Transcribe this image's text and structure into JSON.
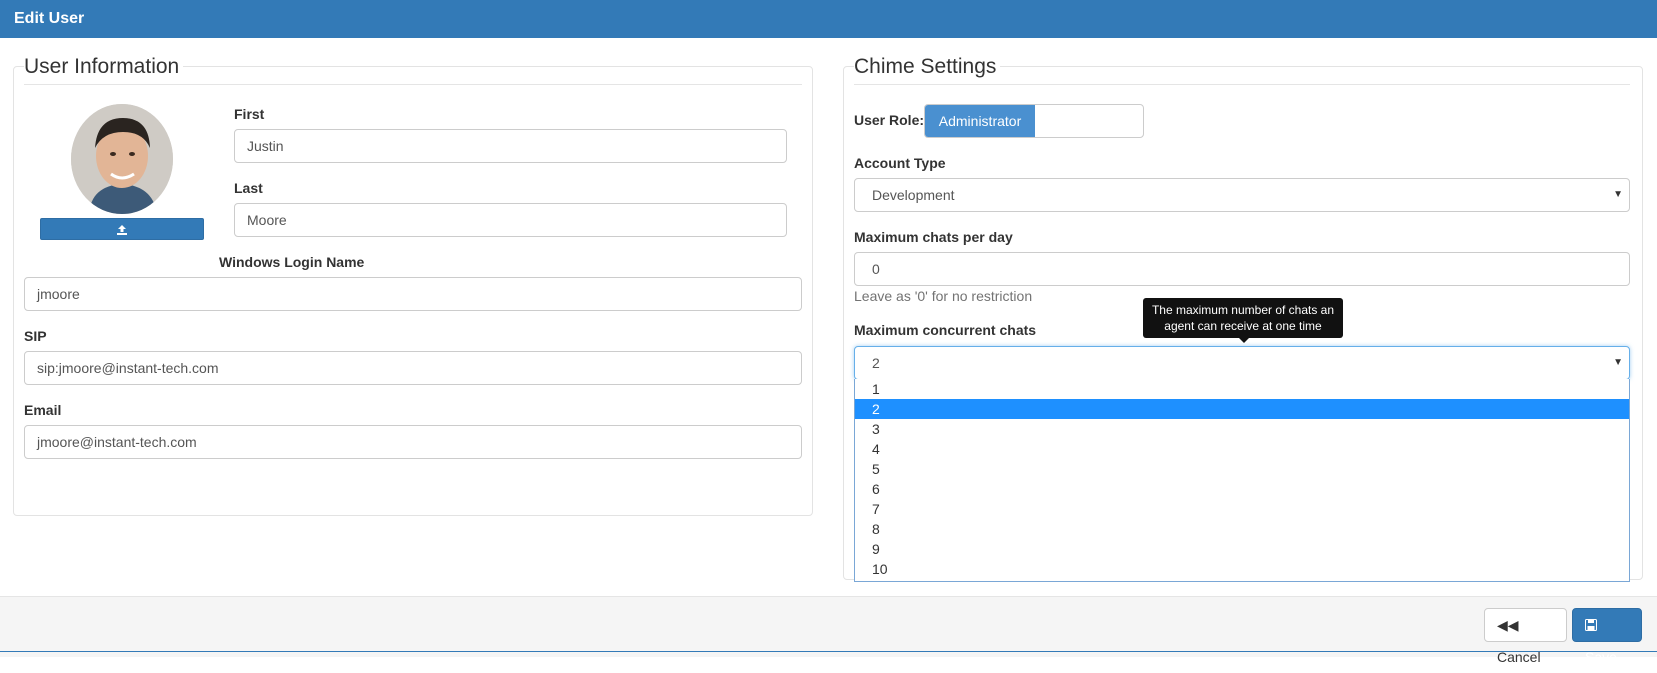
{
  "window": {
    "title": "Edit User"
  },
  "user_info": {
    "legend": "User Information",
    "first_label": "First",
    "first_value": "Justin",
    "last_label": "Last",
    "last_value": "Moore",
    "windows_login_label": "Windows Login Name",
    "windows_login_value": "jmoore",
    "sip_label": "SIP",
    "sip_value": "sip:jmoore@instant-tech.com",
    "email_label": "Email",
    "email_value": "jmoore@instant-tech.com",
    "upload_icon": "upload-icon"
  },
  "chime": {
    "legend": "Chime Settings",
    "role_label": "User Role:",
    "role_active": "Administrator",
    "account_type_label": "Account Type",
    "account_type_value": "Development",
    "max_chats_label": "Maximum chats per day",
    "max_chats_value": "0",
    "max_chats_help": "Leave as '0' for no restriction",
    "max_concurrent_label": "Maximum concurrent chats",
    "max_concurrent_value": "2",
    "tooltip_line1": "The maximum number of chats an",
    "tooltip_line2": "agent can receive at one time",
    "options": [
      "1",
      "2",
      "3",
      "4",
      "5",
      "6",
      "7",
      "8",
      "9",
      "10"
    ],
    "selected_option": "2"
  },
  "footer": {
    "cancel_label": "Cancel",
    "save_label": "Save"
  },
  "colors": {
    "primary": "#337ab7",
    "selected": "#1e90ff"
  }
}
